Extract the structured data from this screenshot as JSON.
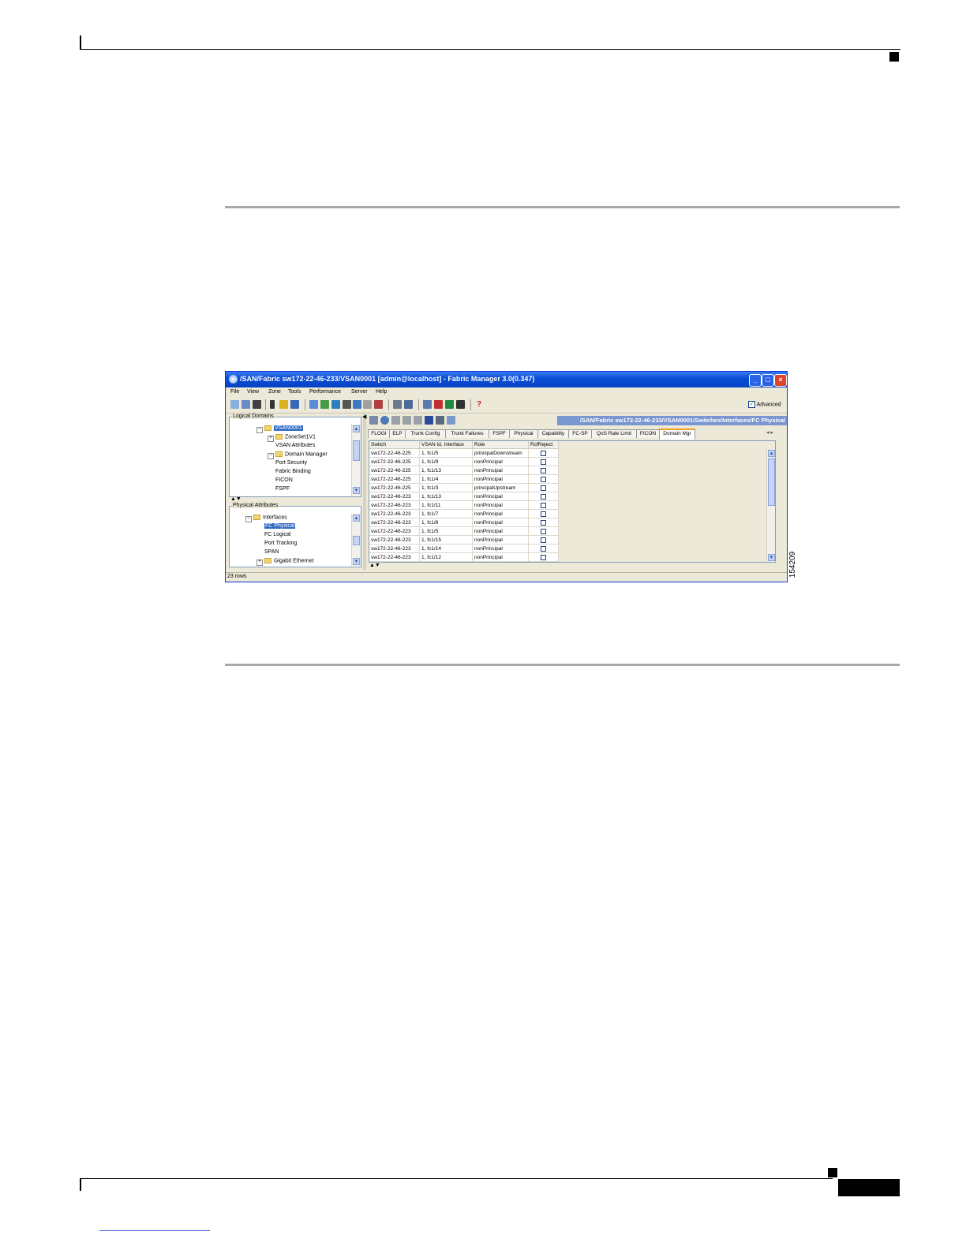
{
  "window": {
    "title": "/SAN/Fabric sw172-22-46-233/VSAN0001 [admin@localhost] - Fabric Manager 3.0(0.347)",
    "menu": [
      "File",
      "View",
      "Zone",
      "Tools",
      "Performance",
      "Server",
      "Help"
    ],
    "advanced_label": "Advanced",
    "advanced_checked": "✓",
    "path": "/SAN/Fabric sw172-22-46-233/VSAN0001/Switches/Interfaces/FC Physical",
    "status": "23 rows"
  },
  "logical_domains": {
    "label": "Logical Domains",
    "items": [
      "VSAN0001",
      "ZoneSet1V1",
      "VSAN Attributes",
      "Domain Manager",
      "Port Security",
      "Fabric Binding",
      "FICON",
      "FSPF"
    ]
  },
  "physical_attributes": {
    "label": "Physical Attributes",
    "items": [
      "Interfaces",
      "FC Physical",
      "FC Logical",
      "Port Tracking",
      "SPAN",
      "Gigabit Ethernet"
    ]
  },
  "tabs": [
    "FLOGI",
    "ELP",
    "Trunk Config",
    "Trunk Failures",
    "FSPF",
    "Physical",
    "Capability",
    "FC-SP",
    "QoS Rate Limit",
    "FICON",
    "Domain Mgr"
  ],
  "table": {
    "headers": [
      "Switch",
      "VSAN Id, Interface",
      "Role",
      "RcfReject"
    ],
    "rows": [
      [
        "sw172-22-46-225",
        "1, fc1/5",
        "principalDownstream"
      ],
      [
        "sw172-22-46-225",
        "1, fc1/9",
        "nonPrincipal"
      ],
      [
        "sw172-22-46-225",
        "1, fc1/13",
        "nonPrincipal"
      ],
      [
        "sw172-22-46-225",
        "1, fc1/4",
        "nonPrincipal"
      ],
      [
        "sw172-22-46-225",
        "1, fc1/3",
        "principalUpstream"
      ],
      [
        "sw172-22-46-223",
        "1, fc1/13",
        "nonPrincipal"
      ],
      [
        "sw172-22-46-223",
        "1, fc1/11",
        "nonPrincipal"
      ],
      [
        "sw172-22-46-223",
        "1, fc1/7",
        "nonPrincipal"
      ],
      [
        "sw172-22-46-223",
        "1, fc1/8",
        "nonPrincipal"
      ],
      [
        "sw172-22-46-223",
        "1, fc1/5",
        "nonPrincipal"
      ],
      [
        "sw172-22-46-223",
        "1, fc1/15",
        "nonPrincipal"
      ],
      [
        "sw172-22-46-223",
        "1, fc1/14",
        "nonPrincipal"
      ],
      [
        "sw172-22-46-223",
        "1, fc1/12",
        "nonPrincipal"
      ]
    ]
  },
  "figure_id": "154209"
}
